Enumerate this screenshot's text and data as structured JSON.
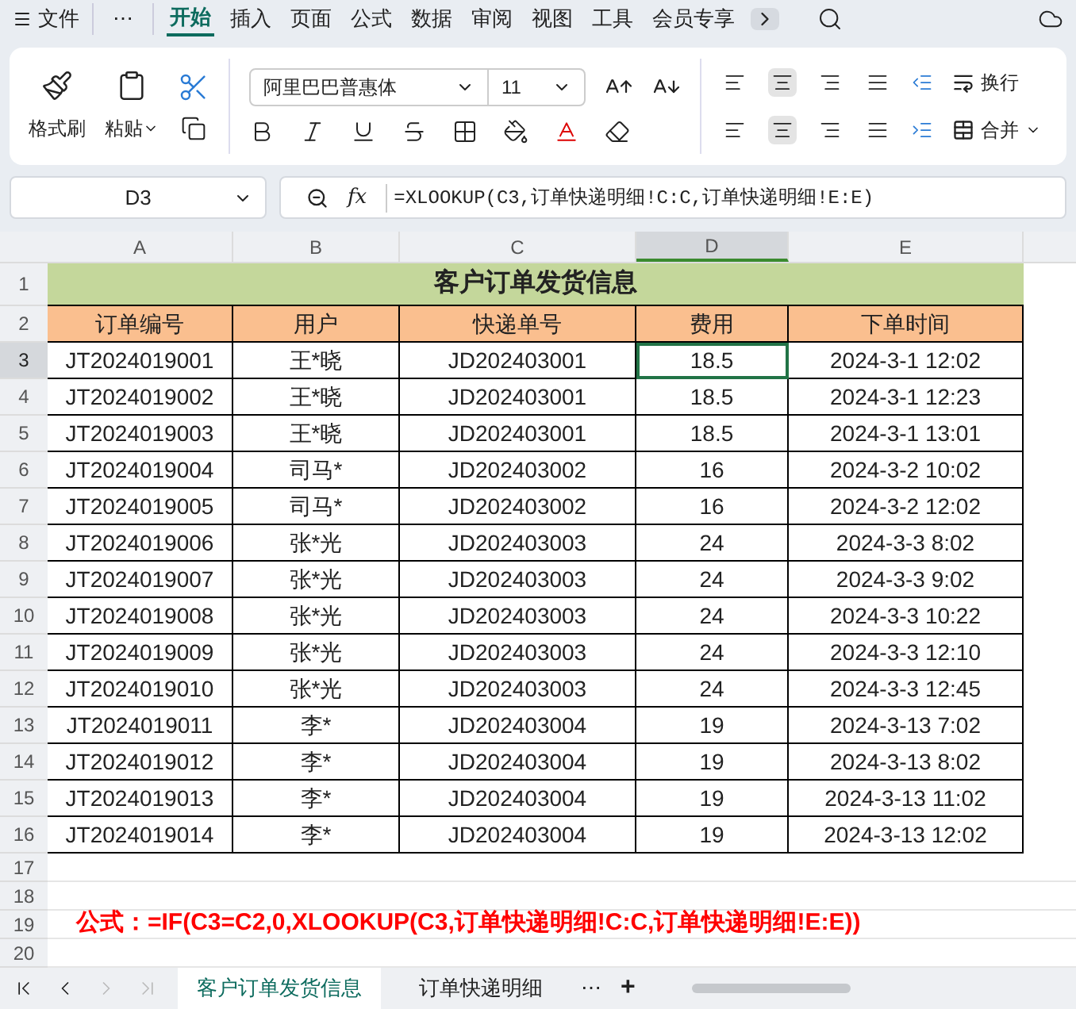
{
  "menu": {
    "file": "文件",
    "more": "⋯",
    "tabs": [
      {
        "label": "开始",
        "selected": true
      },
      {
        "label": "插入",
        "selected": false
      },
      {
        "label": "页面",
        "selected": false
      },
      {
        "label": "公式",
        "selected": false
      },
      {
        "label": "数据",
        "selected": false
      },
      {
        "label": "审阅",
        "selected": false
      },
      {
        "label": "视图",
        "selected": false
      },
      {
        "label": "工具",
        "selected": false
      },
      {
        "label": "会员专享",
        "selected": false
      }
    ]
  },
  "ribbon": {
    "format_painter": "格式刷",
    "paste": "粘贴",
    "font_name": "阿里巴巴普惠体",
    "font_size": "11",
    "wrap": "换行",
    "merge": "合并",
    "v_align": [
      {
        "selected": false
      },
      {
        "selected": true
      },
      {
        "selected": false
      },
      {
        "selected": false
      }
    ],
    "h_align": [
      {
        "selected": false
      },
      {
        "selected": true
      },
      {
        "selected": false
      },
      {
        "selected": false
      }
    ]
  },
  "formula_bar": {
    "name_box": "D3",
    "fx": "fx",
    "formula": "=XLOOKUP(C3,订单快递明细!C:C,订单快递明细!E:E)"
  },
  "columns": [
    {
      "label": "A",
      "selected": false
    },
    {
      "label": "B",
      "selected": false
    },
    {
      "label": "C",
      "selected": false
    },
    {
      "label": "D",
      "selected": true
    },
    {
      "label": "E",
      "selected": false
    }
  ],
  "title_row": {
    "row": "1",
    "text": "客户订单发货信息"
  },
  "header_row": {
    "row": "2",
    "cells": [
      "订单编号",
      "用户",
      "快递单号",
      "费用",
      "下单时间"
    ]
  },
  "rows": [
    {
      "row": "3",
      "selected": true,
      "cells": [
        "JT2024019001",
        "王*晓",
        "JD202403001",
        "18.5",
        "2024-3-1 12:02"
      ]
    },
    {
      "row": "4",
      "selected": false,
      "cells": [
        "JT2024019002",
        "王*晓",
        "JD202403001",
        "18.5",
        "2024-3-1 12:23"
      ]
    },
    {
      "row": "5",
      "selected": false,
      "cells": [
        "JT2024019003",
        "王*晓",
        "JD202403001",
        "18.5",
        "2024-3-1 13:01"
      ]
    },
    {
      "row": "6",
      "selected": false,
      "cells": [
        "JT2024019004",
        "司马*",
        "JD202403002",
        "16",
        "2024-3-2 10:02"
      ]
    },
    {
      "row": "7",
      "selected": false,
      "cells": [
        "JT2024019005",
        "司马*",
        "JD202403002",
        "16",
        "2024-3-2 12:02"
      ]
    },
    {
      "row": "8",
      "selected": false,
      "cells": [
        "JT2024019006",
        "张*光",
        "JD202403003",
        "24",
        "2024-3-3 8:02"
      ]
    },
    {
      "row": "9",
      "selected": false,
      "cells": [
        "JT2024019007",
        "张*光",
        "JD202403003",
        "24",
        "2024-3-3 9:02"
      ]
    },
    {
      "row": "10",
      "selected": false,
      "cells": [
        "JT2024019008",
        "张*光",
        "JD202403003",
        "24",
        "2024-3-3 10:22"
      ]
    },
    {
      "row": "11",
      "selected": false,
      "cells": [
        "JT2024019009",
        "张*光",
        "JD202403003",
        "24",
        "2024-3-3 12:10"
      ]
    },
    {
      "row": "12",
      "selected": false,
      "cells": [
        "JT2024019010",
        "张*光",
        "JD202403003",
        "24",
        "2024-3-3 12:45"
      ]
    },
    {
      "row": "13",
      "selected": false,
      "cells": [
        "JT2024019011",
        "李*",
        "JD202403004",
        "19",
        "2024-3-13 7:02"
      ]
    },
    {
      "row": "14",
      "selected": false,
      "cells": [
        "JT2024019012",
        "李*",
        "JD202403004",
        "19",
        "2024-3-13 8:02"
      ]
    },
    {
      "row": "15",
      "selected": false,
      "cells": [
        "JT2024019013",
        "李*",
        "JD202403004",
        "19",
        "2024-3-13 11:02"
      ]
    },
    {
      "row": "16",
      "selected": false,
      "cells": [
        "JT2024019014",
        "李*",
        "JD202403004",
        "19",
        "2024-3-13 12:02"
      ]
    }
  ],
  "empty_rows": [
    {
      "row": "17"
    },
    {
      "row": "18"
    },
    {
      "row": "19",
      "note": "公式：=IF(C3=C2,0,XLOOKUP(C3,订单快递明细!C:C,订单快递明细!E:E))"
    },
    {
      "row": "20"
    }
  ],
  "sheet_tabs": [
    {
      "label": "客户订单发货信息",
      "selected": true
    },
    {
      "label": "订单快递明细",
      "selected": false
    }
  ],
  "sheet_more": "⋯",
  "sheet_add": "+"
}
